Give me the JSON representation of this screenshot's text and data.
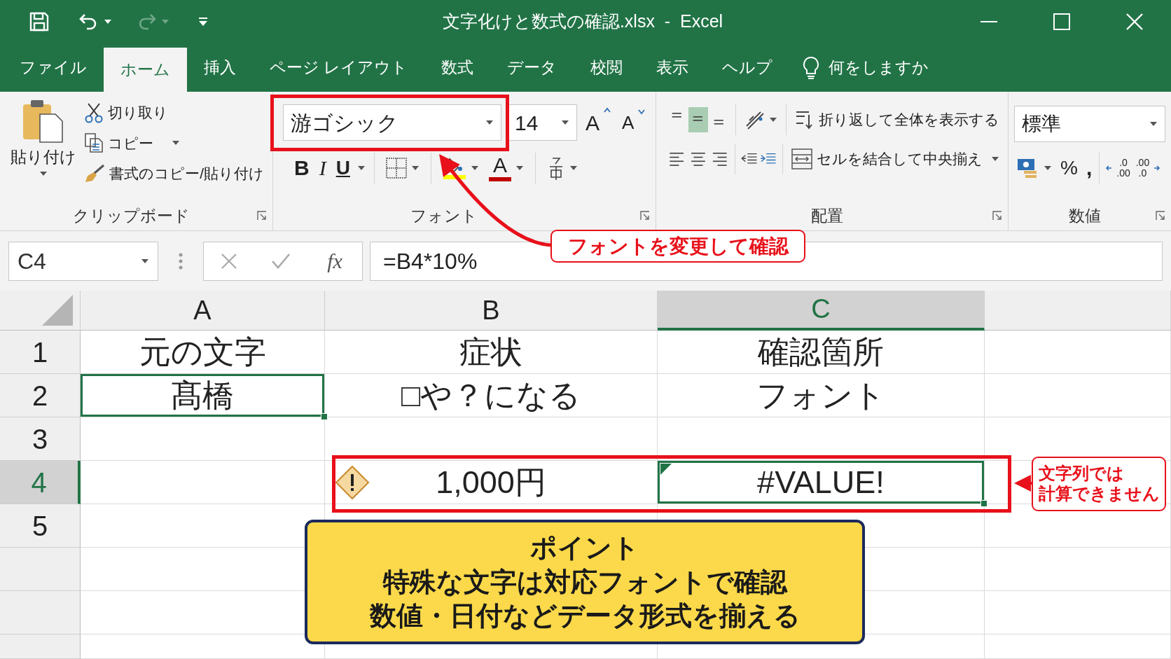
{
  "window": {
    "title": "文字化けと数式の確認.xlsx  -  Excel"
  },
  "tabs": [
    {
      "label": "ファイル",
      "selected": false
    },
    {
      "label": "ホーム",
      "selected": true
    },
    {
      "label": "挿入",
      "selected": false
    },
    {
      "label": "ページ レイアウト",
      "selected": false
    },
    {
      "label": "数式",
      "selected": false
    },
    {
      "label": "データ",
      "selected": false
    },
    {
      "label": "校閲",
      "selected": false
    },
    {
      "label": "表示",
      "selected": false
    },
    {
      "label": "ヘルプ",
      "selected": false
    }
  ],
  "tell_me": {
    "label": "何をしますか"
  },
  "ribbon": {
    "clipboard": {
      "paste": "貼り付け",
      "cut": "切り取り",
      "copy": "コピー",
      "format_painter": "書式のコピー/貼り付け",
      "label": "クリップボード"
    },
    "font": {
      "font_name": "游ゴシック",
      "font_size": "14",
      "grow": "A",
      "shrink": "A",
      "bold": "B",
      "italic": "I",
      "underline": "U",
      "font_color": "A",
      "label": "フォント"
    },
    "alignment": {
      "vertical": [
        {
          "selected": false
        },
        {
          "selected": true
        },
        {
          "selected": false
        }
      ],
      "wrap_text": "折り返して全体を表示する",
      "merge": "セルを結合して中央揃え",
      "label": "配置"
    },
    "number": {
      "format": "標準",
      "percent": "%",
      "comma": ",",
      "increase_decimal": [
        ".0",
        ".00"
      ],
      "decrease_decimal": [
        ".00",
        ".0"
      ],
      "label": "数値"
    }
  },
  "formula_bar": {
    "name_box": "C4",
    "fx": "fx",
    "formula": "=B4*10%"
  },
  "sheet": {
    "columns": [
      {
        "label": "A",
        "selected": false
      },
      {
        "label": "B",
        "selected": false
      },
      {
        "label": "C",
        "selected": true
      }
    ],
    "rows": [
      {
        "label": "1",
        "selected": false,
        "cells": [
          {
            "text": "元の文字",
            "selected": false
          },
          {
            "text": "症状",
            "selected": false
          },
          {
            "text": "確認箇所",
            "selected": false
          }
        ]
      },
      {
        "label": "2",
        "selected": false,
        "cells": [
          {
            "text": "髙橋",
            "selected": true
          },
          {
            "text": "□や？になる",
            "selected": false
          },
          {
            "text": "フォント",
            "selected": false
          }
        ]
      },
      {
        "label": "3",
        "selected": false,
        "cells": [
          {
            "selected": false
          },
          {
            "selected": false
          },
          {
            "selected": false
          }
        ]
      },
      {
        "label": "4",
        "selected": true,
        "cells": [
          {
            "selected": false
          },
          {
            "text": "1,000円",
            "selected": false,
            "warning": true
          },
          {
            "text": "#VALUE!",
            "selected": true,
            "error_indicator": true
          }
        ]
      },
      {
        "label": "5",
        "selected": false,
        "cells": [
          {
            "selected": false
          },
          {
            "selected": false
          },
          {
            "selected": false
          }
        ]
      }
    ]
  },
  "callouts": [
    {
      "lines": [
        "フォントを変更して確認"
      ]
    },
    {
      "lines": [
        "文字列では",
        "計算できません"
      ]
    }
  ],
  "point": {
    "title": "ポイント",
    "lines": [
      "特殊な文字は対応フォントで確認",
      "数値・日付などデータ形式を揃える"
    ]
  }
}
